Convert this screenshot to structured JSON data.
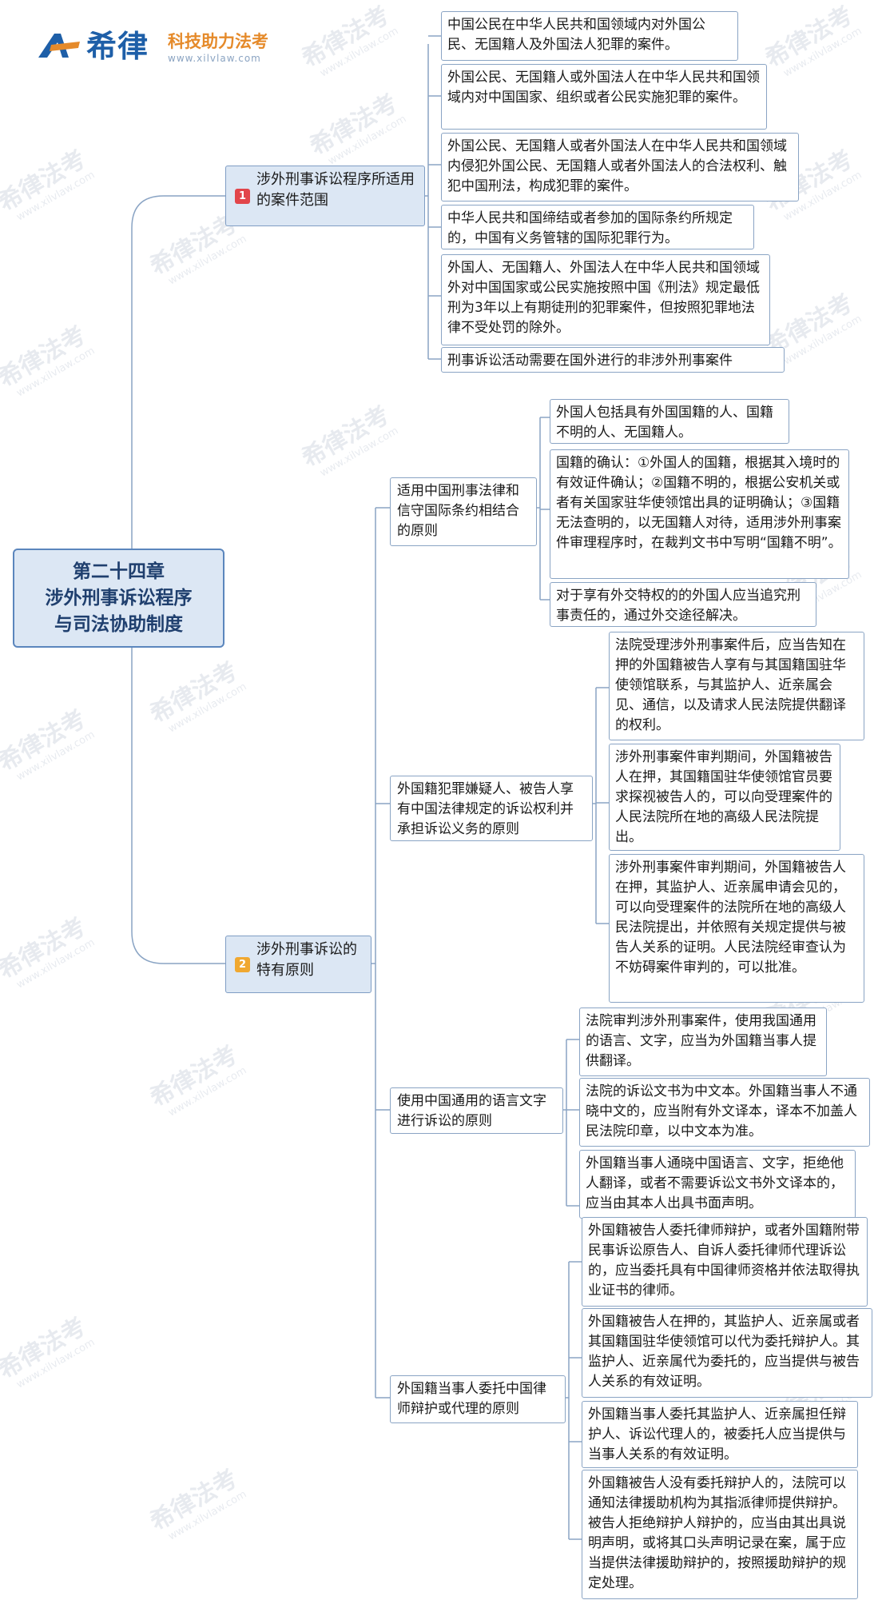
{
  "logo": {
    "name": "希律",
    "slogan": "科技助力法考",
    "url": "www.xilvlaw.com",
    "brand_color": "#1e5fa8",
    "accent_color": "#e58a2a"
  },
  "watermark": {
    "text": "希律法考",
    "url": "www.xilvlaw.com"
  },
  "root": {
    "line1": "第二十四章",
    "line2": "涉外刑事诉讼程序",
    "line3": "与司法协助制度"
  },
  "branches": [
    {
      "badge": "1",
      "label": "涉外刑事诉讼程序所适用的案件范围",
      "items": [
        "中国公民在中华人民共和国领域内对外国公民、无国籍人及外国法人犯罪的案件。",
        "外国公民、无国籍人或外国法人在中华人民共和国领域内对中国国家、组织或者公民实施犯罪的案件。",
        "外国公民、无国籍人或者外国法人在中华人民共和国领域内侵犯外国公民、无国籍人或者外国法人的合法权利、触犯中国刑法，构成犯罪的案件。",
        "中华人民共和国缔结或者参加的国际条约所规定的，中国有义务管辖的国际犯罪行为。",
        "外国人、无国籍人、外国法人在中华人民共和国领域外对中国国家或公民实施按照中国《刑法》规定最低刑为3年以上有期徒刑的犯罪案件，但按照犯罪地法律不受处罚的除外。",
        "刑事诉讼活动需要在国外进行的非涉外刑事案件"
      ]
    },
    {
      "badge": "2",
      "label": "涉外刑事诉讼的特有原则",
      "principles": [
        {
          "label": "适用中国刑事法律和信守国际条约相结合的原则",
          "items": [
            "外国人包括具有外国国籍的人、国籍不明的人、无国籍人。",
            "国籍的确认：①外国人的国籍，根据其入境时的有效证件确认；②国籍不明的，根据公安机关或者有关国家驻华使领馆出具的证明确认；③国籍无法查明的，以无国籍人对待，适用涉外刑事案件审理程序时，在裁判文书中写明“国籍不明”。",
            "对于享有外交特权的的外国人应当追究刑事责任的，通过外交途径解决。"
          ]
        },
        {
          "label": "外国籍犯罪嫌疑人、被告人享有中国法律规定的诉讼权利并承担诉讼义务的原则",
          "items": [
            "法院受理涉外刑事案件后，应当告知在押的外国籍被告人享有与其国籍国驻华使领馆联系，与其监护人、近亲属会见、通信，以及请求人民法院提供翻译的权利。",
            "涉外刑事案件审判期间，外国籍被告人在押，其国籍国驻华使领馆官员要求探视被告人的，可以向受理案件的人民法院所在地的高级人民法院提出。",
            "涉外刑事案件审判期间，外国籍被告人在押，其监护人、近亲属申请会见的，可以向受理案件的法院所在地的高级人民法院提出，并依照有关规定提供与被告人关系的证明。人民法院经审查认为不妨碍案件审判的，可以批准。"
          ]
        },
        {
          "label": "使用中国通用的语言文字进行诉讼的原则",
          "items": [
            "法院审判涉外刑事案件，使用我国通用的语言、文字，应当为外国籍当事人提供翻译。",
            "法院的诉讼文书为中文本。外国籍当事人不通晓中文的，应当附有外文译本，译本不加盖人民法院印章，以中文本为准。",
            "外国籍当事人通晓中国语言、文字，拒绝他人翻译，或者不需要诉讼文书外文译本的，应当由其本人出具书面声明。"
          ]
        },
        {
          "label": "外国籍当事人委托中国律师辩护或代理的原则",
          "items": [
            "外国籍被告人委托律师辩护，或者外国籍附带民事诉讼原告人、自诉人委托律师代理诉讼的，应当委托具有中国律师资格并依法取得执业证书的律师。",
            "外国籍被告人在押的，其监护人、近亲属或者其国籍国驻华使领馆可以代为委托辩护人。其监护人、近亲属代为委托的，应当提供与被告人关系的有效证明。",
            "外国籍当事人委托其监护人、近亲属担任辩护人、诉讼代理人的，被委托人应当提供与当事人关系的有效证明。",
            "外国籍被告人没有委托辩护人的，法院可以通知法律援助机构为其指派律师提供辩护。被告人拒绝辩护人辩护的，应当由其出具说明声明，或将其口头声明记录在案，属于应当提供法律援助辩护的，按照援助辩护的规定处理。"
          ]
        }
      ]
    }
  ]
}
